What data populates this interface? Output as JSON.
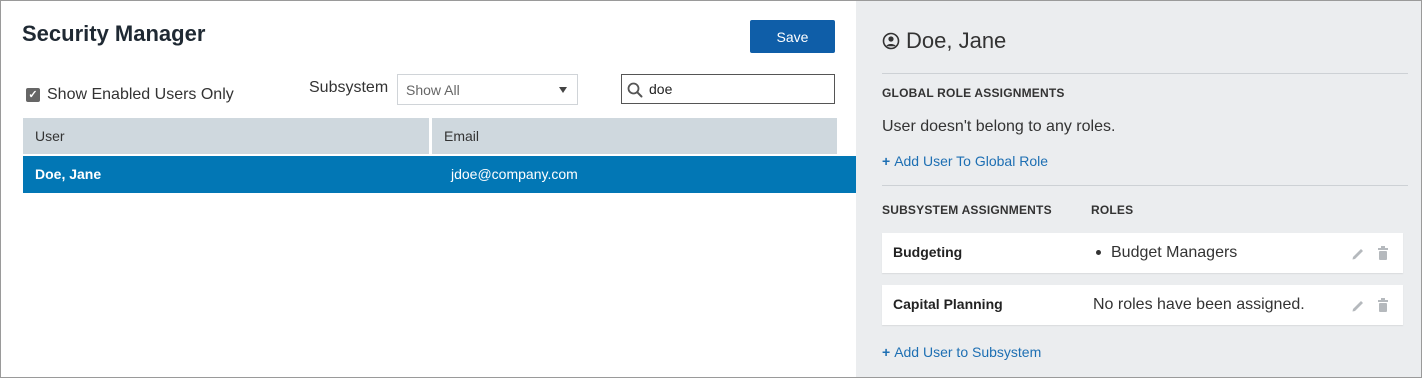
{
  "left": {
    "title": "Security Manager",
    "save_label": "Save",
    "show_enabled_label": "Show Enabled Users Only",
    "show_enabled_checked": true,
    "subsystem_label": "Subsystem",
    "subsystem_value": "Show All",
    "search_value": "doe",
    "table": {
      "columns": [
        "User",
        "Email"
      ],
      "rows": [
        {
          "user": "Doe, Jane",
          "email": "jdoe@company.com",
          "selected": true
        }
      ]
    }
  },
  "right": {
    "user_name": "Doe, Jane",
    "global_header": "GLOBAL ROLE ASSIGNMENTS",
    "global_message": "User doesn't belong to any roles.",
    "add_global_label": "Add User To Global Role",
    "subsystem_header": "SUBSYSTEM ASSIGNMENTS",
    "roles_header": "ROLES",
    "assignments": [
      {
        "subsystem": "Budgeting",
        "role": "Budget Managers",
        "bulleted": true
      },
      {
        "subsystem": "Capital Planning",
        "role": "No roles have been assigned.",
        "bulleted": false
      }
    ],
    "add_subsystem_label": "Add User to Subsystem"
  },
  "colors": {
    "accent": "#0f5ea8",
    "selected_row": "#0277b5",
    "link": "#1d6fb3",
    "right_pane_bg": "#ebedef"
  },
  "icons": [
    "checkbox-icon",
    "chevron-down-icon",
    "search-icon",
    "user-circle-icon",
    "plus-icon",
    "pencil-icon",
    "trash-icon"
  ]
}
